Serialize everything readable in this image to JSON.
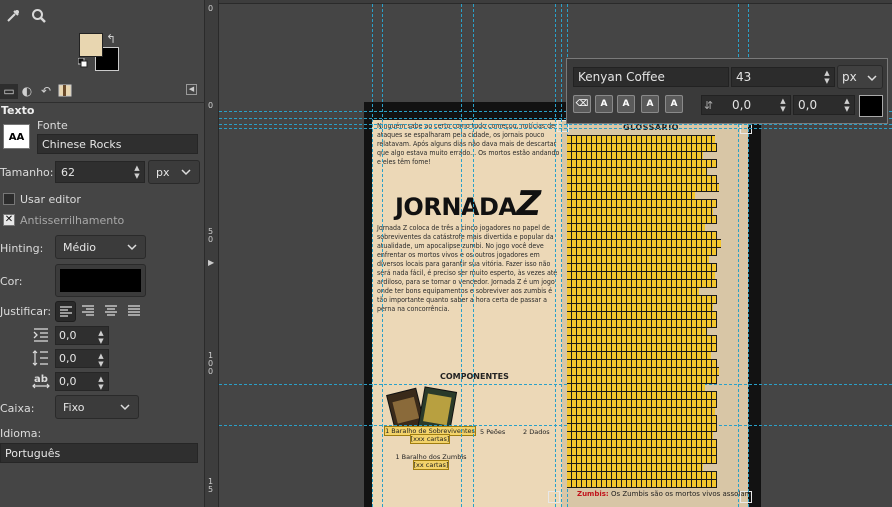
{
  "left_panel": {
    "tool_icons": [
      "color-picker-icon",
      "zoom-icon"
    ],
    "fg_color": "#e8d6b0",
    "bg_color": "#000000",
    "tab_icons": [
      "tool-options-icon",
      "device-status-icon",
      "undo-history-icon",
      "images-icon"
    ],
    "title": "Texto",
    "font": {
      "label": "Fonte",
      "thumb": "AA",
      "value": "Chinese Rocks"
    },
    "size": {
      "label": "Tamanho:",
      "value": "62",
      "unit": "px"
    },
    "use_editor": "Usar editor",
    "antialias": "Antisserrilhamento",
    "hinting": {
      "label": "Hinting:",
      "value": "Médio"
    },
    "color": {
      "label": "Cor:",
      "value": "#000000"
    },
    "justify": {
      "label": "Justificar:"
    },
    "indent": "0,0",
    "line_spacing": "0,0",
    "letter_spacing": "0,0",
    "box": {
      "label": "Caixa:",
      "value": "Fixo"
    },
    "language": {
      "label": "Idioma:",
      "value": "Português"
    }
  },
  "rulers": {
    "horizontal": [
      "0"
    ],
    "vertical": [
      "0",
      "5\n0",
      "1\n0\n0",
      "1\n5"
    ]
  },
  "document": {
    "intro": "Ninguém sabe ao certo como tudo começou, notícias de ataques se espalharam pela cidade, os jornais pouco relatavam. Após alguns dias não dava mais de descartar que algo estava muito errado... Os mortos estão andando e eles têm fome!",
    "logo": "JORNADA",
    "logo_z": "Z",
    "description": "Jornada Z coloca de três a cinco jogadores no papel de sobreviventes da catástrofe mais divertida e popular da atualidade, um apocalipse zumbi. No jogo você deve enfrentar os mortos vivos e os outros jogadores em diversos locais para garantir sua vitória. Fazer isso não será nada fácil, é preciso ser muito esperto, às vezes até ardiloso, para se tornar o vencedor. Jornada Z é um jogo onde ter bons equipamentos e sobreviver aos zumbis é tão importante quanto saber a hora certa de passar a perna na concorrência.",
    "components_title": "COMPONENTES",
    "comp1": "1 Baralho de Sobreviventes",
    "comp1_count": "[xxx cartas]",
    "comp2": "5 Peões",
    "comp3": "2 Dados",
    "comp4": "1 Baralho dos Zumbis",
    "comp4_count": "[xx cartas]",
    "glossary_title": "GLOSSÁRIO",
    "glossary_last_term": "Zumbis:",
    "glossary_last_text": " Os Zumbis são os mortos vivos assolam"
  },
  "text_toolbox": {
    "font": "Kenyan Coffee",
    "size": "43",
    "unit": "px",
    "buttons": [
      "clear-style",
      "A",
      "A",
      "A",
      "A"
    ],
    "baseline": "0,0",
    "kerning": "0,0",
    "color": "#000000"
  }
}
